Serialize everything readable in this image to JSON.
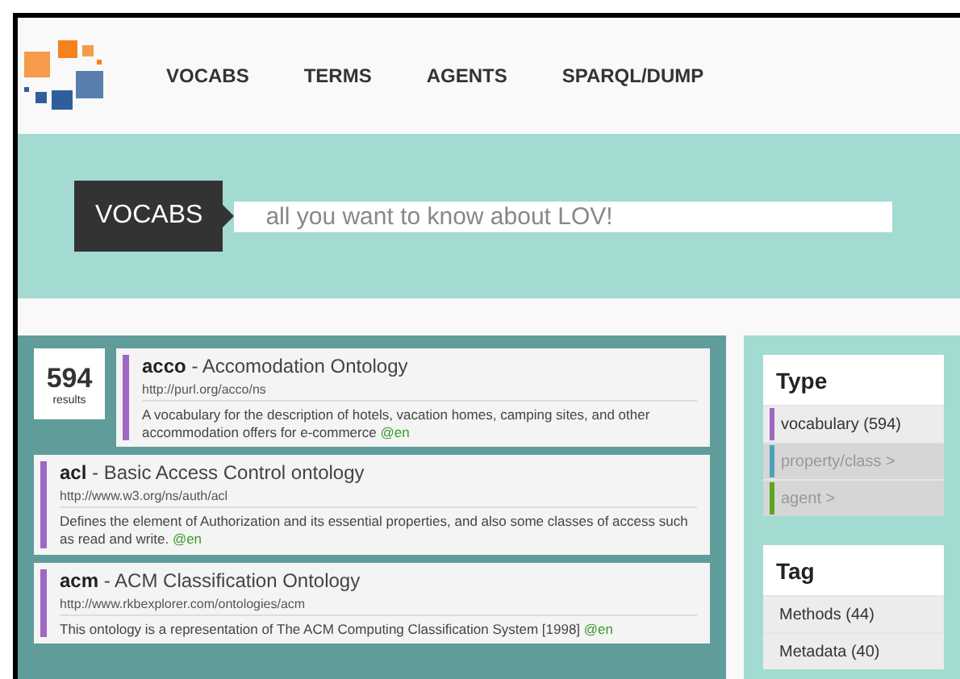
{
  "nav": [
    "VOCABS",
    "TERMS",
    "AGENTS",
    "SPARQL/DUMP"
  ],
  "search": {
    "label": "VOCABS",
    "placeholder": "all you want to know about LOV!"
  },
  "title_separator": " - ",
  "results_count": {
    "number": "594",
    "label": "results"
  },
  "results": [
    {
      "prefix": "acco",
      "title": "Accomodation Ontology",
      "uri": "http://purl.org/acco/ns",
      "description": "A vocabulary for the description of hotels, vacation homes, camping sites, and other accommodation offers for e-commerce",
      "lang": "@en",
      "color": "#a066c4"
    },
    {
      "prefix": "acl",
      "title": "Basic Access Control ontology",
      "uri": "http://www.w3.org/ns/auth/acl",
      "description": "Defines the element of Authorization and its essential properties, and also some classes of access such as read and write.",
      "lang": "@en",
      "color": "#a066c4"
    },
    {
      "prefix": "acm",
      "title": "ACM Classification Ontology",
      "uri": "http://www.rkbexplorer.com/ontologies/acm",
      "description": "This ontology is a representation of The ACM Computing Classification System [1998]",
      "lang": "@en",
      "color": "#a066c4"
    }
  ],
  "facets": [
    {
      "title": "Type",
      "items": [
        {
          "label": "vocabulary (594)",
          "color": "#a066c4",
          "disabled": false
        },
        {
          "label": "property/class >",
          "color": "#4ba3b8",
          "disabled": true
        },
        {
          "label": "agent >",
          "color": "#5ca61a",
          "disabled": true
        }
      ]
    },
    {
      "title": "Tag",
      "items": [
        {
          "label": "Methods (44)",
          "disabled": false
        },
        {
          "label": "Metadata (40)",
          "disabled": false
        }
      ]
    }
  ]
}
